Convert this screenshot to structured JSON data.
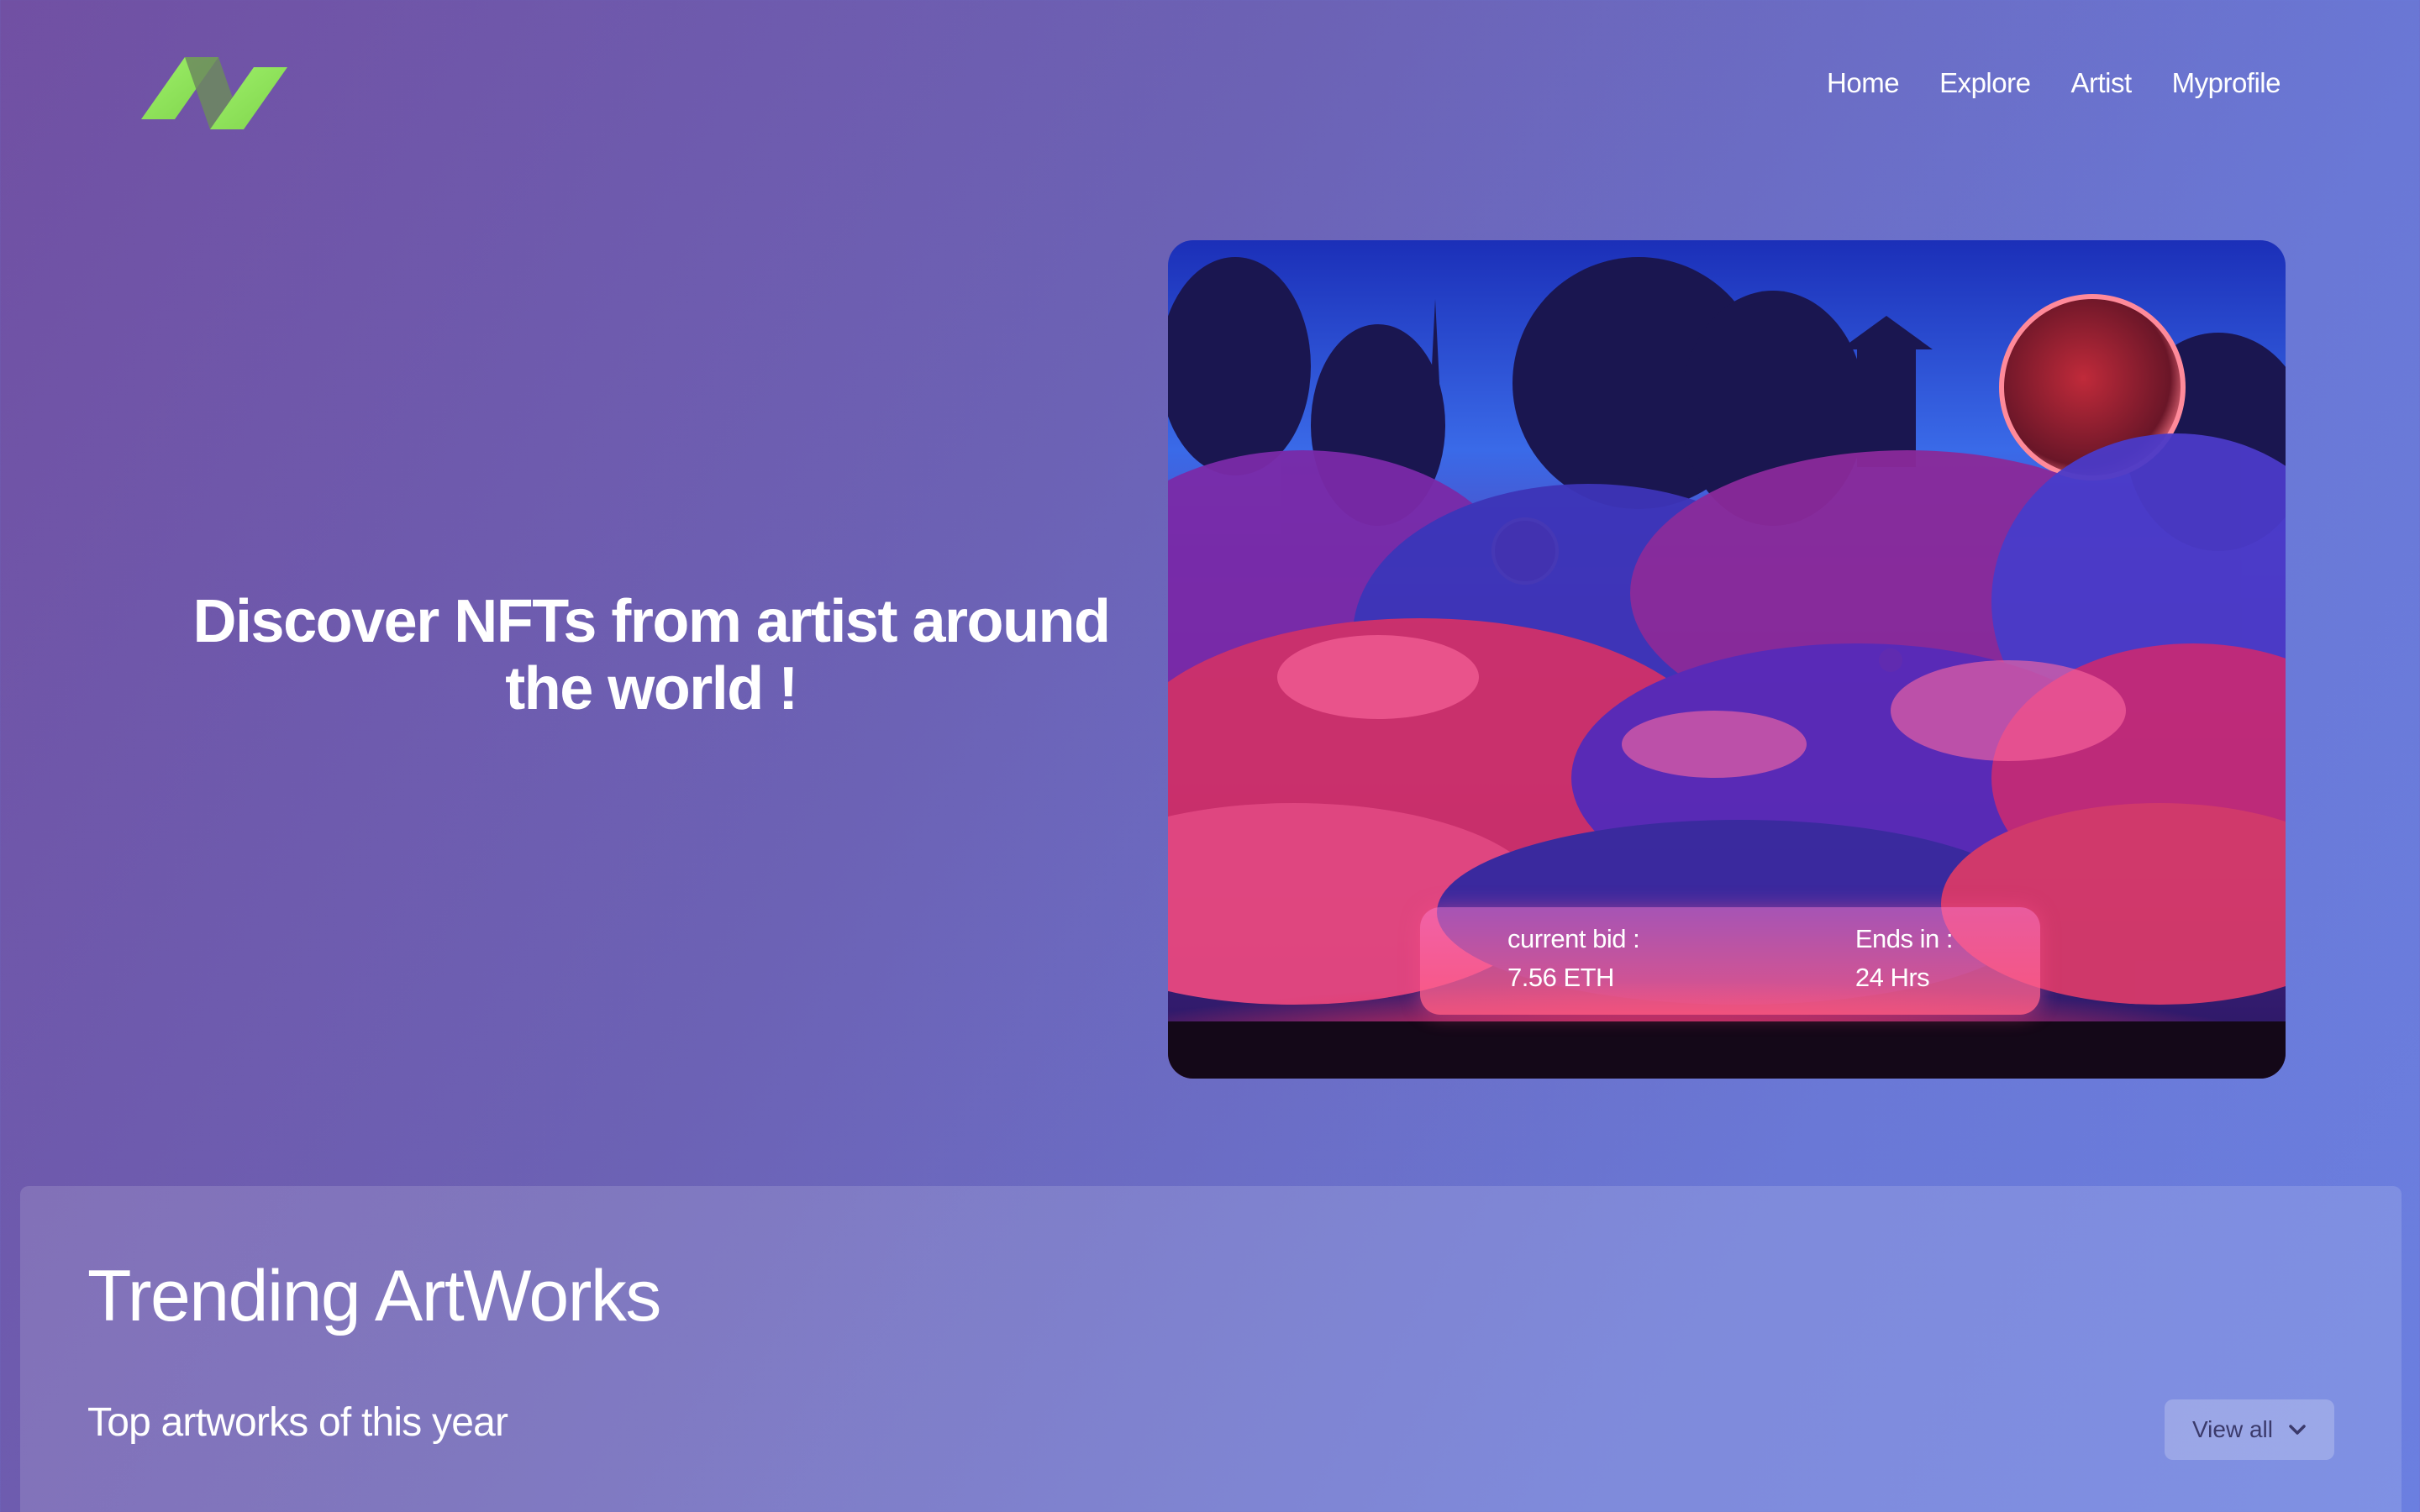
{
  "header": {
    "logo_name": "brand-logo",
    "nav": [
      "Home",
      "Explore",
      "Artist",
      "Myprofile"
    ]
  },
  "hero": {
    "title_line1": "Discover NFTs from artist around",
    "title_line2": "the world !",
    "bid_label": "current bid :",
    "bid_value": "7.56 ETH",
    "ends_label": "Ends in :",
    "ends_value": "24 Hrs"
  },
  "trending": {
    "title": "Trending ArtWorks",
    "subtitle": "Top artworks of this year",
    "view_all": "View all"
  },
  "colors": {
    "logo_green": "#8ee65b",
    "background_start": "#7150a3",
    "background_end": "#6b7fe0"
  }
}
